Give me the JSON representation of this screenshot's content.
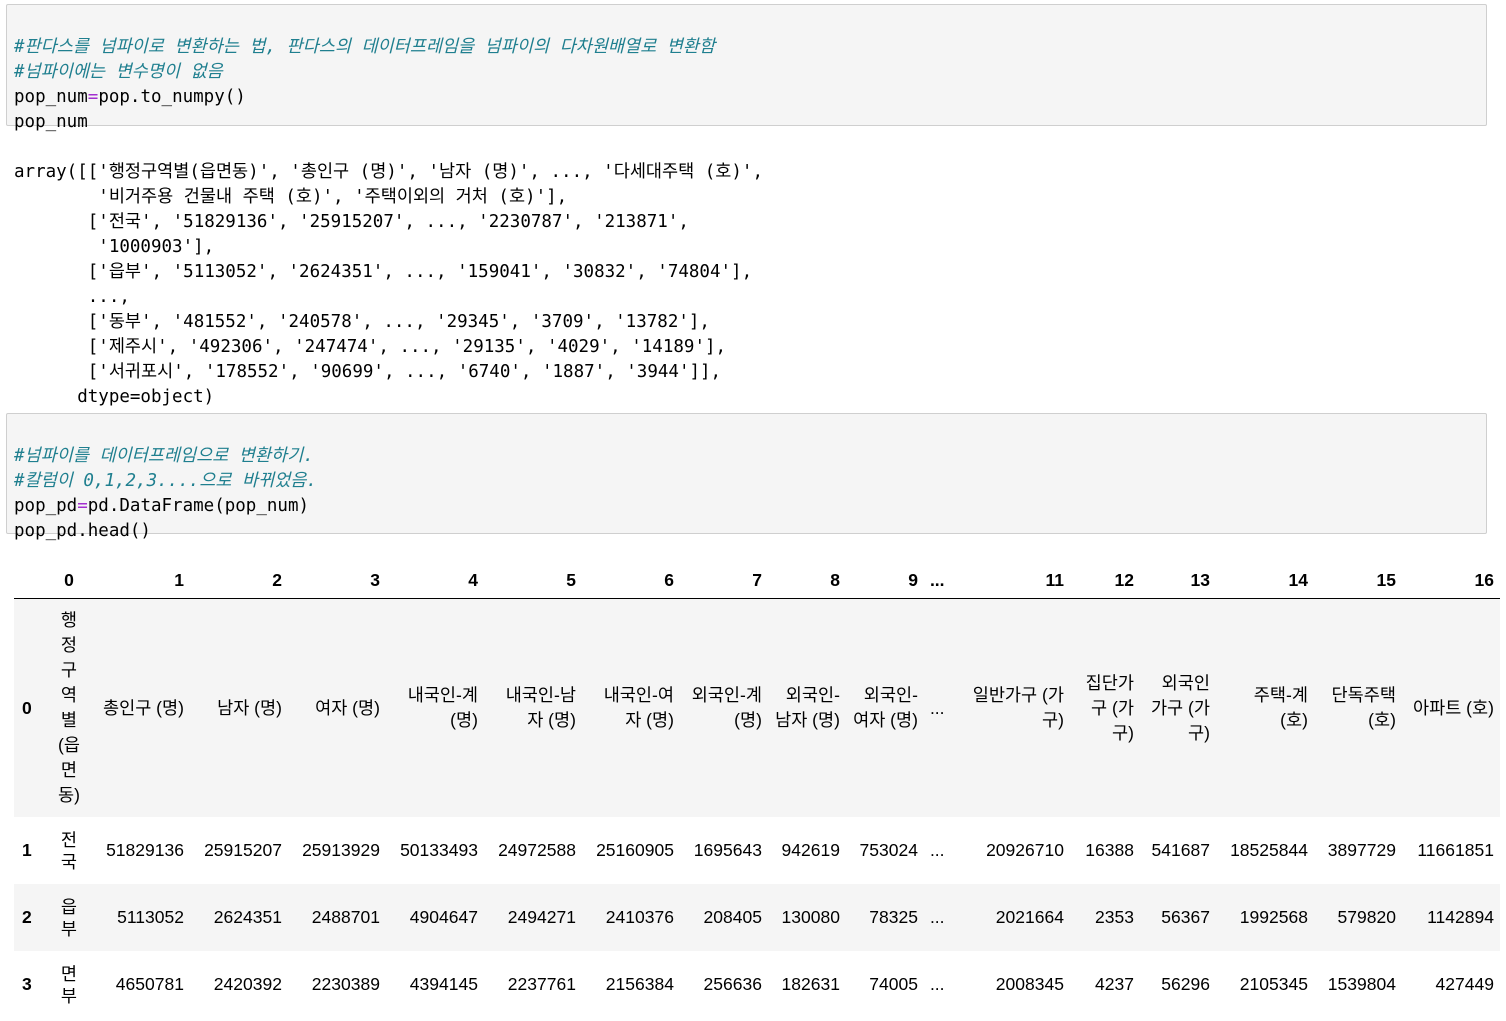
{
  "cell1": {
    "comment1": "#판다스를 넘파이로 변환하는 법, 판다스의 데이터프레임을 넘파이의 다차원배열로 변환함",
    "comment2": "#넘파이에는 변수명이 없음",
    "line3a": "pop_num",
    "line3op": "=",
    "line3b": "pop.to_numpy()",
    "line4": "pop_num"
  },
  "output1": {
    "lines": [
      "array([['행정구역별(읍면동)', '총인구 (명)', '남자 (명)', ..., '다세대주택 (호)',",
      "        '비거주용 건물내 주택 (호)', '주택이외의 거처 (호)'],",
      "       ['전국', '51829136', '25915207', ..., '2230787', '213871',",
      "        '1000903'],",
      "       ['읍부', '5113052', '2624351', ..., '159041', '30832', '74804'],",
      "       ...,",
      "       ['동부', '481552', '240578', ..., '29345', '3709', '13782'],",
      "       ['제주시', '492306', '247474', ..., '29135', '4029', '14189'],",
      "       ['서귀포시', '178552', '90699', ..., '6740', '1887', '3944']],",
      "      dtype=object)"
    ]
  },
  "cell2": {
    "comment1": "#넘파이를 데이터프레임으로 변환하기.",
    "comment2": "#칼럼이 0,1,2,3....으로 바뀌었음.",
    "line3a": "pop_pd",
    "line3op": "=",
    "line3b": "pd.DataFrame(pop_num)",
    "line4": "pop_pd.head()"
  },
  "dataframe": {
    "columns": [
      "0",
      "1",
      "2",
      "3",
      "4",
      "5",
      "6",
      "7",
      "8",
      "9",
      "...",
      "11",
      "12",
      "13",
      "14",
      "15",
      "16"
    ],
    "rows": [
      {
        "index": "0",
        "cells": [
          "행정구역별(읍면동)",
          "총인구 (명)",
          "남자 (명)",
          "여자 (명)",
          "내국인-계 (명)",
          "내국인-남자 (명)",
          "내국인-여자 (명)",
          "외국인-계 (명)",
          "외국인-남자 (명)",
          "외국인-여자 (명)",
          "...",
          "일반가구 (가구)",
          "집단가구 (가구)",
          "외국인가구 (가구)",
          "주택-계 (호)",
          "단독주택 (호)",
          "아파트 (호)"
        ]
      },
      {
        "index": "1",
        "cells": [
          "전국",
          "51829136",
          "25915207",
          "25913929",
          "50133493",
          "24972588",
          "25160905",
          "1695643",
          "942619",
          "753024",
          "...",
          "20926710",
          "16388",
          "541687",
          "18525844",
          "3897729",
          "11661851"
        ]
      },
      {
        "index": "2",
        "cells": [
          "읍부",
          "5113052",
          "2624351",
          "2488701",
          "4904647",
          "2494271",
          "2410376",
          "208405",
          "130080",
          "78325",
          "...",
          "2021664",
          "2353",
          "56367",
          "1992568",
          "579820",
          "1142894"
        ]
      },
      {
        "index": "3",
        "cells": [
          "면부",
          "4650781",
          "2420392",
          "2230389",
          "4394145",
          "2237761",
          "2156384",
          "256636",
          "182631",
          "74005",
          "...",
          "2008345",
          "4237",
          "56296",
          "2105345",
          "1539804",
          "427449"
        ]
      }
    ]
  }
}
